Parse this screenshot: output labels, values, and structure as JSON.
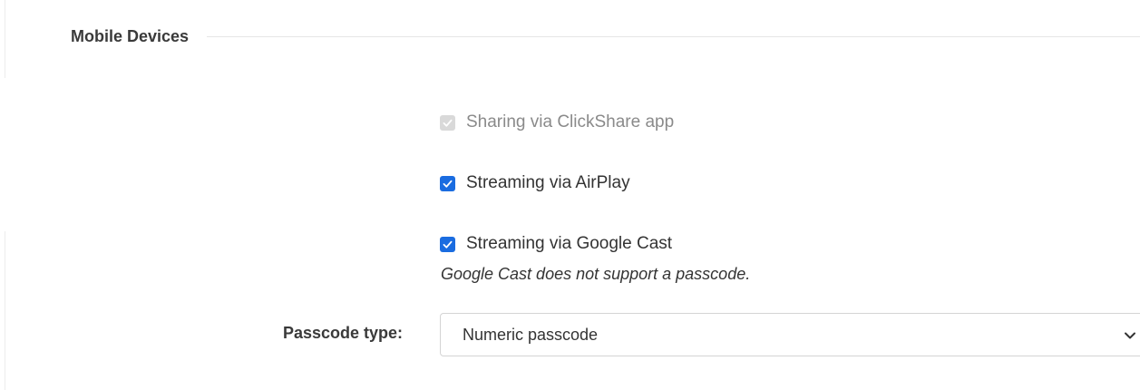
{
  "section": {
    "title": "Mobile Devices"
  },
  "options": [
    {
      "label": "Sharing via ClickShare app",
      "checked": true,
      "disabled": true
    },
    {
      "label": "Streaming via AirPlay",
      "checked": true,
      "disabled": false
    },
    {
      "label": "Streaming via Google Cast",
      "checked": true,
      "disabled": false
    }
  ],
  "google_cast_note": "Google Cast does not support a passcode.",
  "passcode": {
    "label": "Passcode type:",
    "selected": "Numeric passcode"
  },
  "colors": {
    "accent": "#1a6ce0",
    "disabled": "#d9d9d9"
  },
  "icons": {
    "checkmark": "checkmark-icon",
    "dropdown": "chevron-down-icon"
  }
}
